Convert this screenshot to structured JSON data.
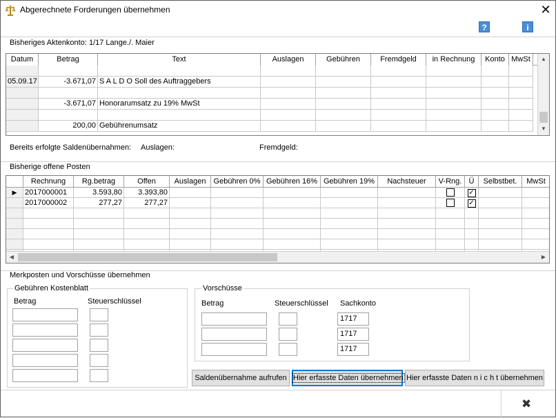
{
  "window": {
    "title": "Abgerechnete Forderungen übernehmen",
    "close_symbol": "✕"
  },
  "toolbar": {
    "help_glyph": "?",
    "info_glyph": "i"
  },
  "account": {
    "label": "Bisheriges Aktenkonto: 1/17 Lange./. Maier",
    "columns": [
      "Datum",
      "Betrag",
      "Text",
      "Auslagen",
      "Gebühren",
      "Fremdgeld",
      "in Rechnung",
      "Konto",
      "MwSt"
    ],
    "rows": [
      [
        "",
        "",
        "",
        "",
        "",
        "",
        "",
        "",
        ""
      ],
      [
        "05.09.17",
        "-3.671,07",
        "S A L D O  Soll des Auftraggebers",
        "",
        "",
        "",
        "",
        "",
        ""
      ],
      [
        "",
        "",
        "",
        "",
        "",
        "",
        "",
        "",
        ""
      ],
      [
        "",
        "-3.671,07",
        "Honorarumsatz zu 19% MwSt",
        "",
        "",
        "",
        "",
        "",
        ""
      ],
      [
        "",
        "",
        "",
        "",
        "",
        "",
        "",
        "",
        ""
      ],
      [
        "",
        "200,00",
        "Gebührenumsatz",
        "",
        "",
        "",
        "",
        "",
        ""
      ]
    ]
  },
  "summary": {
    "label": "Bereits erfolgte Saldenübernahmen:",
    "auslagen_label": "Auslagen:",
    "fremdgeld_label": "Fremdgeld:"
  },
  "open_items": {
    "label": "Bisherige offene Posten",
    "columns": [
      "Rechnung",
      "Rg.betrag",
      "Offen",
      "Auslagen",
      "Gebühren 0%",
      "Gebühren 16%",
      "Gebühren 19%",
      "Nachsteuer",
      "V-Rng.",
      "Ü",
      "Selbstbet.",
      "MwSt"
    ],
    "rows": [
      {
        "marker": "▶",
        "rechnung": "2017000001",
        "rgbetrag": "3.593,80",
        "offen": "3.393,80",
        "vrng": false,
        "ue": true
      },
      {
        "marker": "",
        "rechnung": "2017000002",
        "rgbetrag": "277,27",
        "offen": "277,27",
        "vrng": false,
        "ue": true
      }
    ],
    "empty_rows": 5
  },
  "merk": {
    "label": "Merkposten und Vorschüsse übernehmen",
    "kostenblatt": {
      "label": "Gebühren Kostenblatt",
      "betrag_label": "Betrag",
      "steuer_label": "Steuerschlüssel",
      "rows": 5
    },
    "vorschuesse": {
      "label": "Vorschüsse",
      "betrag_label": "Betrag",
      "steuer_label": "Steuerschlüssel",
      "sachkonto_label": "Sachkonto",
      "sachkonto_values": [
        "1717",
        "1717",
        "1717"
      ]
    }
  },
  "buttons": {
    "saldo": "Saldenübernahme aufrufen",
    "accept": "Hier erfasste Daten übernehmen",
    "decline": "Hier erfasste Daten n i c h t übernehmen",
    "footer_close": "✖"
  }
}
